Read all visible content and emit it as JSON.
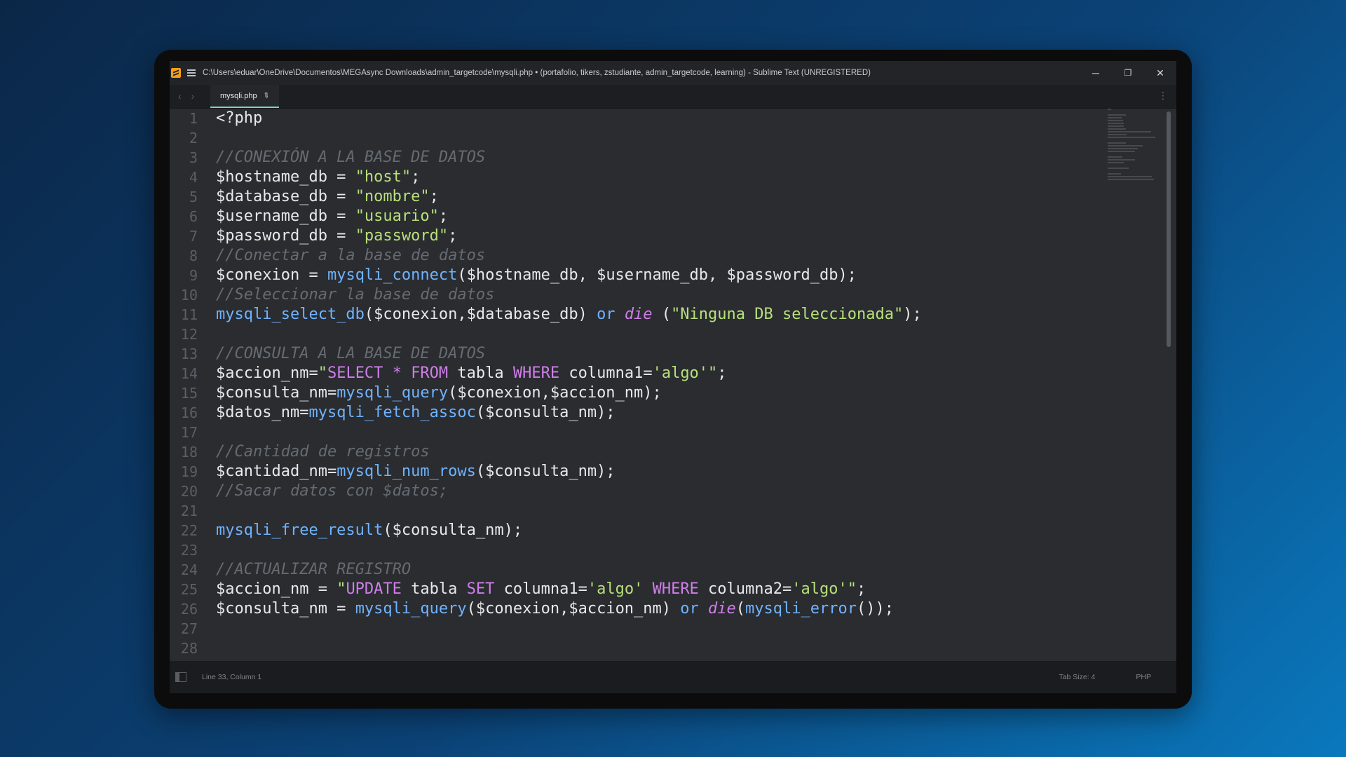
{
  "window": {
    "title": "C:\\Users\\eduar\\OneDrive\\Documentos\\MEGAsync Downloads\\admin_targetcode\\mysqli.php • (portafolio, tikers, zstudiante, admin_targetcode, learning) - Sublime Text (UNREGISTERED)",
    "icon": "sublime-text-icon",
    "controls": {
      "minimize": "─",
      "restore": "❐",
      "close": "✕"
    }
  },
  "tabs": [
    {
      "label": "mysqli.php",
      "dirty": true
    }
  ],
  "nav": {
    "back": "‹",
    "forward": "›",
    "more": "⋮"
  },
  "line_numbers": [
    "1",
    "2",
    "3",
    "4",
    "5",
    "6",
    "7",
    "8",
    "9",
    "10",
    "11",
    "12",
    "13",
    "14",
    "15",
    "16",
    "17",
    "18",
    "19",
    "20",
    "21",
    "22",
    "23",
    "24",
    "25",
    "26",
    "27",
    "28"
  ],
  "code": [
    [
      [
        "tag",
        "<?php"
      ]
    ],
    [],
    [
      [
        "c",
        "//CONEXIÓN A LA BASE DE DATOS"
      ]
    ],
    [
      [
        "v",
        "$hostname_db = "
      ],
      [
        "str",
        "\"host\""
      ],
      [
        "p",
        ";"
      ]
    ],
    [
      [
        "v",
        "$database_db = "
      ],
      [
        "str",
        "\"nombre\""
      ],
      [
        "p",
        ";"
      ]
    ],
    [
      [
        "v",
        "$username_db = "
      ],
      [
        "str",
        "\"usuario\""
      ],
      [
        "p",
        ";"
      ]
    ],
    [
      [
        "v",
        "$password_db = "
      ],
      [
        "str",
        "\"password\""
      ],
      [
        "p",
        ";"
      ]
    ],
    [
      [
        "c",
        "//Conectar a la base de datos"
      ]
    ],
    [
      [
        "v",
        "$conexion = "
      ],
      [
        "fn",
        "mysqli_connect"
      ],
      [
        "p",
        "($hostname_db, $username_db, $password_db);"
      ]
    ],
    [
      [
        "c",
        "//Seleccionar la base de datos"
      ]
    ],
    [
      [
        "fn",
        "mysqli_select_db"
      ],
      [
        "p",
        "($conexion,$database_db) "
      ],
      [
        "kw",
        "or"
      ],
      [
        "p",
        " "
      ],
      [
        "ital",
        "die"
      ],
      [
        "p",
        " ("
      ],
      [
        "str",
        "\"Ninguna DB seleccionada\""
      ],
      [
        "p",
        ");"
      ]
    ],
    [],
    [
      [
        "c",
        "//CONSULTA A LA BASE DE DATOS"
      ]
    ],
    [
      [
        "v",
        "$accion_nm="
      ],
      [
        "str",
        "\""
      ],
      [
        "sql",
        "SELECT"
      ],
      [
        "str",
        " "
      ],
      [
        "sql",
        "*"
      ],
      [
        "str",
        " "
      ],
      [
        "sql",
        "FROM"
      ],
      [
        "p",
        " tabla "
      ],
      [
        "sql",
        "WHERE"
      ],
      [
        "p",
        " columna1="
      ],
      [
        "str",
        "'algo'\""
      ],
      [
        "p",
        ";"
      ]
    ],
    [
      [
        "v",
        "$consulta_nm="
      ],
      [
        "fn",
        "mysqli_query"
      ],
      [
        "p",
        "($conexion,$accion_nm);"
      ]
    ],
    [
      [
        "v",
        "$datos_nm="
      ],
      [
        "fn",
        "mysqli_fetch_assoc"
      ],
      [
        "p",
        "($consulta_nm);"
      ]
    ],
    [],
    [
      [
        "c",
        "//Cantidad de registros"
      ]
    ],
    [
      [
        "v",
        "$cantidad_nm="
      ],
      [
        "fn",
        "mysqli_num_rows"
      ],
      [
        "p",
        "($consulta_nm);"
      ]
    ],
    [
      [
        "c",
        "//Sacar datos con $datos;"
      ]
    ],
    [],
    [
      [
        "fn",
        "mysqli_free_result"
      ],
      [
        "p",
        "($consulta_nm);"
      ]
    ],
    [],
    [
      [
        "c",
        "//ACTUALIZAR REGISTRO"
      ]
    ],
    [
      [
        "v",
        "$accion_nm = "
      ],
      [
        "str",
        "\""
      ],
      [
        "sql",
        "UPDATE"
      ],
      [
        "p",
        " tabla "
      ],
      [
        "sql",
        "SET"
      ],
      [
        "p",
        " columna1="
      ],
      [
        "str",
        "'algo'"
      ],
      [
        "p",
        " "
      ],
      [
        "sql",
        "WHERE"
      ],
      [
        "p",
        " columna2="
      ],
      [
        "str",
        "'algo'\""
      ],
      [
        "p",
        ";"
      ]
    ],
    [
      [
        "v",
        "$consulta_nm = "
      ],
      [
        "fn",
        "mysqli_query"
      ],
      [
        "p",
        "($conexion,$accion_nm) "
      ],
      [
        "kw",
        "or"
      ],
      [
        "p",
        " "
      ],
      [
        "ital",
        "die"
      ],
      [
        "p",
        "("
      ],
      [
        "fn",
        "mysqli_error"
      ],
      [
        "p",
        "());"
      ]
    ],
    [],
    []
  ],
  "status": {
    "position": "Line 33, Column 1",
    "tab_size": "Tab Size: 4",
    "syntax": "PHP"
  },
  "colors": {
    "comment": "#666b72",
    "string": "#b8e07a",
    "function": "#6fb3ff",
    "sql_keyword": "#cf7ee8",
    "tab_underline": "#7ad3c2"
  }
}
